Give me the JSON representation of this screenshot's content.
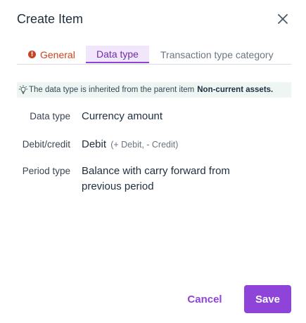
{
  "dialog": {
    "title": "Create Item",
    "close_icon": "close-icon"
  },
  "tabs": [
    {
      "label": "General",
      "status_icon": "error-icon",
      "status_color": "#c8431f"
    },
    {
      "label": "Data type",
      "active": true
    },
    {
      "label": "Transaction type category"
    }
  ],
  "info": {
    "icon": "lightbulb-icon",
    "text": "The data type is inherited from the parent item",
    "parent_item": "Non-current assets."
  },
  "fields": {
    "data_type": {
      "label": "Data type",
      "value": "Currency amount"
    },
    "debit_credit": {
      "label": "Debit/credit",
      "value": "Debit",
      "hint": "(+ Debit, - Credit)"
    },
    "period_type": {
      "label": "Period type",
      "value_line1": "Balance with carry forward from",
      "value_line2": "previous period"
    }
  },
  "actions": {
    "cancel_label": "Cancel",
    "save_label": "Save"
  },
  "colors": {
    "accent": "#8e44d8",
    "error": "#c8431f",
    "info_background": "#eef6f4"
  }
}
